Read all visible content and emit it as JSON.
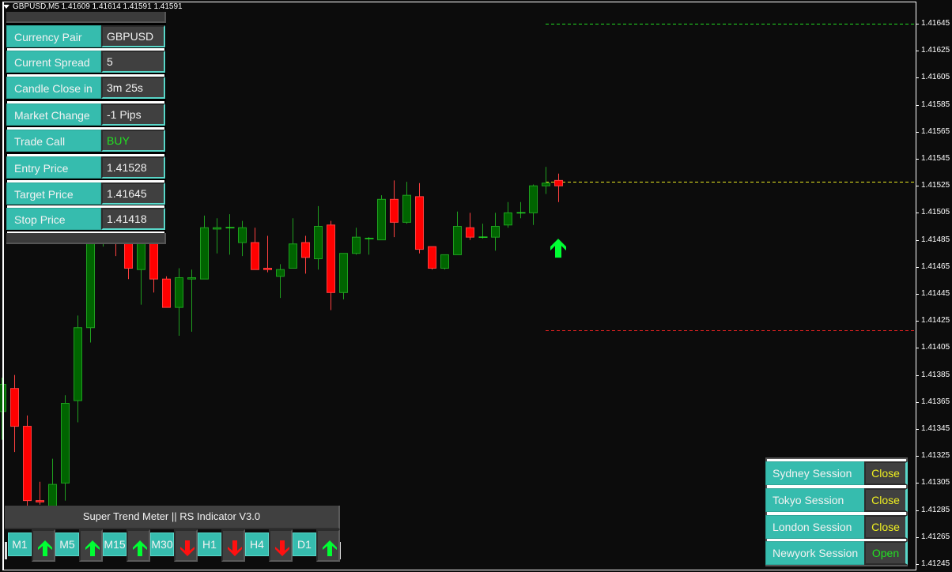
{
  "chart": {
    "title": "GBPUSD,M5  1.41609 1.41614 1.41591 1.41591",
    "symbol": "GBPUSD",
    "timeframe": "M5",
    "price_axis": [
      "1.41645",
      "1.41625",
      "1.41605",
      "1.41585",
      "1.41565",
      "1.41545",
      "1.41525",
      "1.41505",
      "1.41485",
      "1.41465",
      "1.41445",
      "1.41425",
      "1.41405",
      "1.41385",
      "1.41365",
      "1.41345",
      "1.41325",
      "1.41305",
      "1.41285",
      "1.41265",
      "1.41245"
    ],
    "price_axis_top": 1.41645,
    "price_axis_step": 0.0002,
    "target_line": {
      "price": 1.41645,
      "color": "#22dd22"
    },
    "entry_line": {
      "price": 1.41528,
      "color": "#e8e820"
    },
    "stop_line": {
      "price": 1.41418,
      "color": "#e02020"
    },
    "signal": {
      "type": "buy-arrow",
      "price": 1.4148,
      "color": "#00ff33"
    },
    "colors": {
      "bull": "#006400",
      "bull_border": "#1f9f1f",
      "bear": "#ff0000",
      "bear_border": "#ff4040",
      "background": "#0c0c0c"
    },
    "candles": [
      {
        "o": 1.41358,
        "h": 1.41383,
        "l": 1.41337,
        "c": 1.41378
      },
      {
        "o": 1.41375,
        "h": 1.41385,
        "l": 1.41328,
        "c": 1.41347
      },
      {
        "o": 1.41347,
        "h": 1.41355,
        "l": 1.41288,
        "c": 1.41292
      },
      {
        "o": 1.41292,
        "h": 1.41306,
        "l": 1.41289,
        "c": 1.41291
      },
      {
        "o": 1.41288,
        "h": 1.41323,
        "l": 1.41288,
        "c": 1.41304
      },
      {
        "o": 1.41305,
        "h": 1.4137,
        "l": 1.41292,
        "c": 1.41364
      },
      {
        "o": 1.41366,
        "h": 1.41429,
        "l": 1.4135,
        "c": 1.4142
      },
      {
        "o": 1.4142,
        "h": 1.41505,
        "l": 1.41409,
        "c": 1.41487
      },
      {
        "o": 1.41487,
        "h": 1.4151,
        "l": 1.4148,
        "c": 1.415
      },
      {
        "o": 1.415,
        "h": 1.41505,
        "l": 1.41473,
        "c": 1.41495
      },
      {
        "o": 1.41493,
        "h": 1.41503,
        "l": 1.41456,
        "c": 1.41464
      },
      {
        "o": 1.41463,
        "h": 1.41505,
        "l": 1.41437,
        "c": 1.41498
      },
      {
        "o": 1.41493,
        "h": 1.415,
        "l": 1.41446,
        "c": 1.41456
      },
      {
        "o": 1.41456,
        "h": 1.41458,
        "l": 1.41435,
        "c": 1.41435
      },
      {
        "o": 1.41435,
        "h": 1.41464,
        "l": 1.41414,
        "c": 1.41457
      },
      {
        "o": 1.41456,
        "h": 1.41463,
        "l": 1.41417,
        "c": 1.41457
      },
      {
        "o": 1.41456,
        "h": 1.41503,
        "l": 1.41456,
        "c": 1.41494
      },
      {
        "o": 1.41493,
        "h": 1.41501,
        "l": 1.41475,
        "c": 1.41494
      },
      {
        "o": 1.41494,
        "h": 1.41504,
        "l": 1.41474,
        "c": 1.41494
      },
      {
        "o": 1.41483,
        "h": 1.41499,
        "l": 1.41473,
        "c": 1.41494
      },
      {
        "o": 1.41483,
        "h": 1.41494,
        "l": 1.41463,
        "c": 1.41463
      },
      {
        "o": 1.41464,
        "h": 1.41488,
        "l": 1.41461,
        "c": 1.41463
      },
      {
        "o": 1.41458,
        "h": 1.41467,
        "l": 1.41442,
        "c": 1.41463
      },
      {
        "o": 1.41464,
        "h": 1.41501,
        "l": 1.41464,
        "c": 1.41482
      },
      {
        "o": 1.41483,
        "h": 1.41488,
        "l": 1.4146,
        "c": 1.41472
      },
      {
        "o": 1.41471,
        "h": 1.4151,
        "l": 1.41463,
        "c": 1.41495
      },
      {
        "o": 1.41496,
        "h": 1.41499,
        "l": 1.41433,
        "c": 1.41446
      },
      {
        "o": 1.41446,
        "h": 1.41475,
        "l": 1.41441,
        "c": 1.41475
      },
      {
        "o": 1.41475,
        "h": 1.41494,
        "l": 1.41474,
        "c": 1.41487
      },
      {
        "o": 1.41486,
        "h": 1.41487,
        "l": 1.41474,
        "c": 1.41486
      },
      {
        "o": 1.41485,
        "h": 1.41518,
        "l": 1.41485,
        "c": 1.41515
      },
      {
        "o": 1.41515,
        "h": 1.41529,
        "l": 1.41487,
        "c": 1.41498
      },
      {
        "o": 1.41498,
        "h": 1.41528,
        "l": 1.41497,
        "c": 1.41518
      },
      {
        "o": 1.41517,
        "h": 1.41527,
        "l": 1.41475,
        "c": 1.41478
      },
      {
        "o": 1.4148,
        "h": 1.4148,
        "l": 1.41463,
        "c": 1.41464
      },
      {
        "o": 1.41464,
        "h": 1.41474,
        "l": 1.41463,
        "c": 1.41474
      },
      {
        "o": 1.41474,
        "h": 1.41506,
        "l": 1.41477,
        "c": 1.41495
      },
      {
        "o": 1.41494,
        "h": 1.41505,
        "l": 1.41485,
        "c": 1.41487
      },
      {
        "o": 1.41487,
        "h": 1.41497,
        "l": 1.41486,
        "c": 1.41487
      },
      {
        "o": 1.41487,
        "h": 1.41505,
        "l": 1.41477,
        "c": 1.41495
      },
      {
        "o": 1.41496,
        "h": 1.41513,
        "l": 1.41494,
        "c": 1.41505
      },
      {
        "o": 1.41505,
        "h": 1.41513,
        "l": 1.41501,
        "c": 1.41505
      },
      {
        "o": 1.41505,
        "h": 1.41526,
        "l": 1.41496,
        "c": 1.41525
      },
      {
        "o": 1.41525,
        "h": 1.41539,
        "l": 1.41519,
        "c": 1.41527
      },
      {
        "o": 1.41529,
        "h": 1.41534,
        "l": 1.41513,
        "c": 1.41525
      }
    ]
  },
  "info_panel": {
    "rows": [
      {
        "label": "Currency Pair",
        "value": "GBPUSD"
      },
      {
        "label": "Current Spread",
        "value": "5"
      },
      {
        "label": "Candle Close in",
        "value": "3m 25s"
      },
      {
        "label": "Market Change",
        "value": "-1   Pips"
      },
      {
        "label": "Trade Call",
        "value": "BUY"
      },
      {
        "label": "Entry Price",
        "value": "1.41528"
      },
      {
        "label": "Target Price",
        "value": "1.41645"
      },
      {
        "label": "Stop Price",
        "value": "1.41418"
      }
    ]
  },
  "trend_meter": {
    "title": "Super Trend Meter  ||  RS Indicator V3.0",
    "timeframes": [
      {
        "label": "M1",
        "direction": "up"
      },
      {
        "label": "M5",
        "direction": "up"
      },
      {
        "label": "M15",
        "direction": "up"
      },
      {
        "label": "M30",
        "direction": "down"
      },
      {
        "label": "H1",
        "direction": "down"
      },
      {
        "label": "H4",
        "direction": "down"
      },
      {
        "label": "D1",
        "direction": "up"
      }
    ],
    "up_color": "#00ff33",
    "down_color": "#ff1010"
  },
  "sessions": {
    "rows": [
      {
        "label": "Sydney Session",
        "status": "Close"
      },
      {
        "label": "Tokyo Session",
        "status": "Close"
      },
      {
        "label": "London Session",
        "status": "Close"
      },
      {
        "label": "Newyork Session",
        "status": "Open"
      }
    ]
  }
}
